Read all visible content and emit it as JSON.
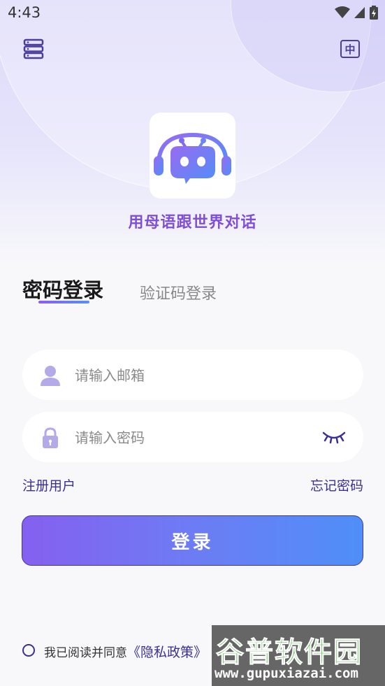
{
  "status_bar": {
    "time": "4:43"
  },
  "header": {
    "language_label": "中"
  },
  "brand": {
    "slogan": "用母语跟世界对话"
  },
  "tabs": {
    "password_login": "密码登录",
    "code_login": "验证码登录"
  },
  "form": {
    "email_placeholder": "请输入邮箱",
    "password_placeholder": "请输入密码"
  },
  "links": {
    "register": "注册用户",
    "forgot_password": "忘记密码"
  },
  "login_button": "登录",
  "agreement": {
    "prefix": "我已阅读并同意",
    "privacy_link": "《隐私政策》"
  },
  "watermark": {
    "name": "谷普软件园",
    "url": "www.gupuxiazai.com"
  },
  "colors": {
    "accent": "#3a2f95",
    "slogan": "#7f4fd6",
    "button_start": "#8560f0",
    "button_end": "#4f8ff7"
  }
}
